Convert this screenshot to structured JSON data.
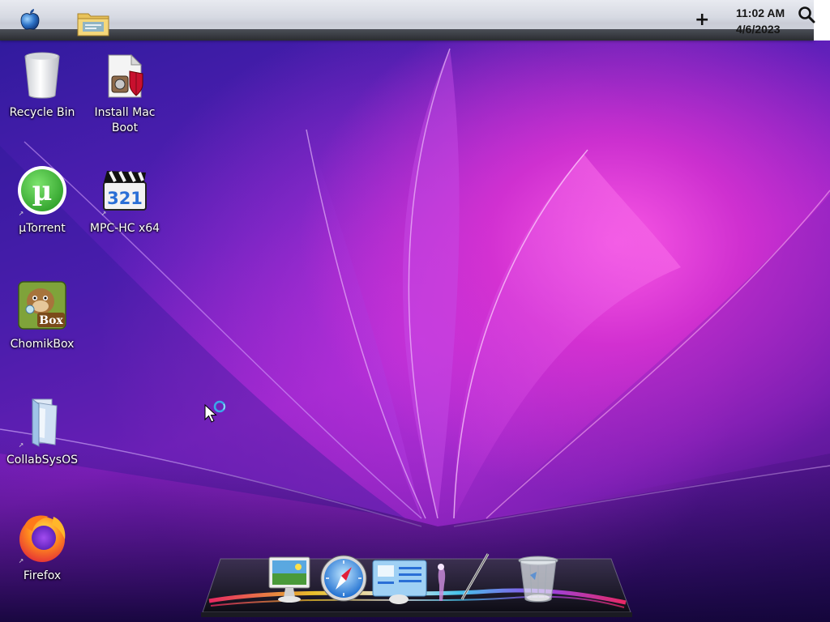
{
  "menubar": {
    "apple_icon": "apple-logo-icon",
    "folder_icon": "folder-icon",
    "plus_label": "+",
    "time": "11:02 AM",
    "date": "4/6/2023",
    "search_icon": "search-icon"
  },
  "desktop_icons": [
    {
      "label": "Recycle Bin",
      "icon": "recycle-bin-icon"
    },
    {
      "label": "Install Mac Boot",
      "icon": "installer-icon"
    },
    {
      "label": "µTorrent",
      "icon": "utorrent-icon"
    },
    {
      "label": "MPC-HC x64",
      "icon": "mpc-hc-icon"
    },
    {
      "label": "ChomikBox",
      "icon": "chomikbox-icon"
    },
    {
      "label": "CollabSysOS",
      "icon": "folder-icon"
    },
    {
      "label": "Firefox",
      "icon": "firefox-icon"
    }
  ],
  "icon_glyphs": {
    "utorrent": "µ",
    "mpc": "321",
    "chomik": "Box"
  },
  "dock": {
    "items": [
      "finder-icon",
      "safari-icon",
      "system-info-icon",
      "paint-brush-icon",
      "trash-icon"
    ]
  },
  "colors": {
    "accent_pink": "#e53bd6",
    "accent_purple": "#6a1fb5",
    "menubar": "#d6d9e2"
  }
}
